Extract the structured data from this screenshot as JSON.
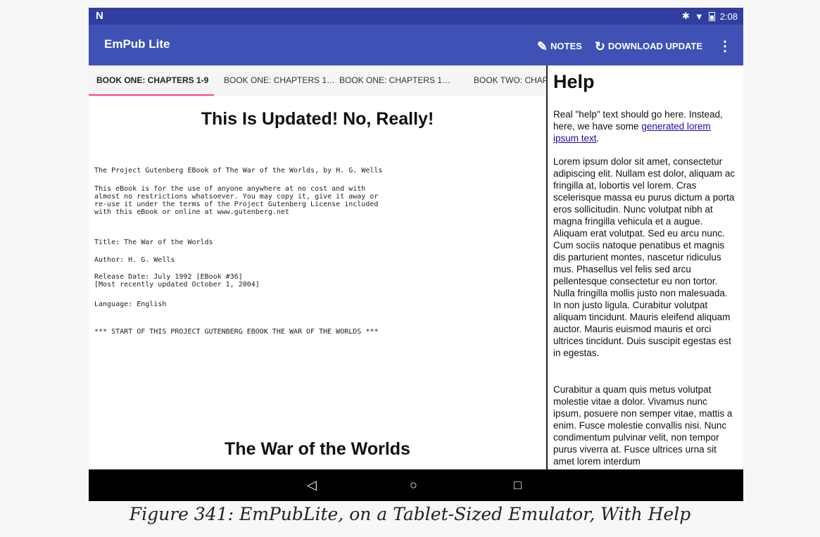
{
  "status_bar": {
    "brand": "N",
    "time": "2:08",
    "bluetooth_icon": "bluetooth-icon",
    "wifi_icon": "wifi-icon",
    "battery_icon": "battery-icon"
  },
  "app_bar": {
    "title": "EmPub Lite",
    "actions": [
      {
        "label": "NOTES",
        "icon": "pencil-icon"
      },
      {
        "label": "DOWNLOAD UPDATE",
        "icon": "refresh-icon"
      }
    ],
    "overflow_icon": "overflow-menu-icon"
  },
  "tabs": [
    "BOOK ONE: CHAPTERS 1-9",
    "BOOK ONE: CHAPTERS 1…",
    "BOOK ONE: CHAPTERS 1…",
    "BOOK TWO: CHAP"
  ],
  "book": {
    "heading": "This Is Updated! No, Really!",
    "lines": [
      "The Project Gutenberg EBook of The War of the Worlds, by H. G. Wells",
      "This eBook is for the use of anyone anywhere at no cost and with\nalmost no restrictions whatsoever. You may copy it, give it away or\nre-use it under the terms of the Project Gutenberg License included\nwith this eBook or online at www.gutenberg.net",
      "Title: The War of the Worlds",
      "Author: H. G. Wells",
      "Release Date: July 1992 [EBook #36]\n[Most recently updated October 1, 2004]",
      "Language: English",
      "*** START OF THIS PROJECT GUTENBERG EBOOK THE WAR OF THE WORLDS ***"
    ],
    "heading2": "The War of the Worlds"
  },
  "help": {
    "title": "Help",
    "intro_before": "Real \"help\" text should go here. Instead, here, we have some ",
    "intro_link": "generated lorem ipsum text",
    "intro_after": ".",
    "para1": "Lorem ipsum dolor sit amet, consectetur adipiscing elit. Nullam est dolor, aliquam ac fringilla at, lobortis vel lorem. Cras scelerisque massa eu purus dictum a porta eros sollicitudin. Nunc volutpat nibh at magna fringilla vehicula et a augue. Aliquam erat volutpat. Sed eu arcu nunc. Cum sociis natoque penatibus et magnis dis parturient montes, nascetur ridiculus mus. Phasellus vel felis sed arcu pellentesque consectetur eu non tortor. Nulla fringilla mollis justo non malesuada. In non justo ligula. Curabitur volutpat aliquam tincidunt. Mauris eleifend aliquam auctor. Mauris euismod mauris et orci ultrices tincidunt. Duis suscipit egestas est in egestas.",
    "para2": "Curabitur a quam quis metus volutpat molestie vitae a dolor. Vivamus nunc ipsum, posuere non semper vitae, mattis a enim. Fusce molestie convallis nisi. Nunc condimentum pulvinar velit, non tempor purus viverra at. Fusce ultrices urna sit amet lorem interdum"
  },
  "nav_bar": {
    "back": "◁",
    "home": "○",
    "recents": "□"
  },
  "caption": "Figure 341: EmPubLite, on a Tablet-Sized Emulator, With Help",
  "colors": {
    "primary": "#3f51b5",
    "primary_dark": "#303f9f",
    "accent": "#ff4081"
  }
}
